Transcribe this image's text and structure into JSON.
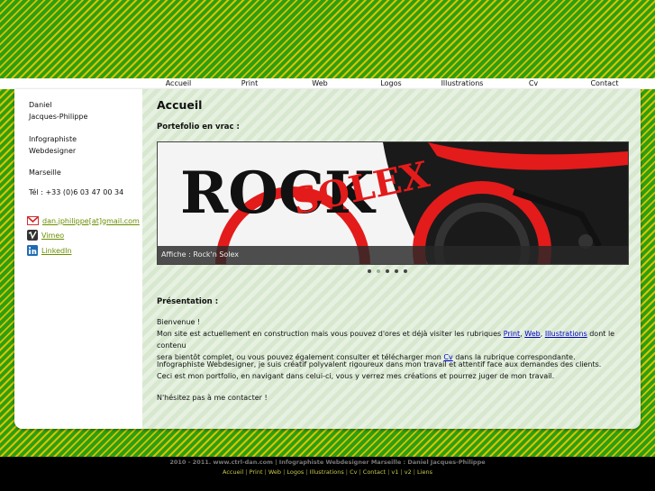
{
  "nav": {
    "items": [
      "Accueil",
      "Print",
      "Web",
      "Logos",
      "Illustrations",
      "Cv",
      "Contact"
    ]
  },
  "sidebar": {
    "name_line1": "Daniel",
    "name_line2": "Jacques-Philippe",
    "job_line1": "Infographiste",
    "job_line2": "Webdesigner",
    "city": "Marseille",
    "phone": "Tél : +33 (0)6 03 47 00 34",
    "links": [
      {
        "icon": "gmail-icon",
        "label": "dan.jphilippe[at]gmail.com"
      },
      {
        "icon": "vimeo-icon",
        "label": "Vimeo"
      },
      {
        "icon": "linkedin-icon",
        "label": "LinkedIn"
      }
    ]
  },
  "main": {
    "title": "Accueil",
    "portfolio_heading": "Portefolio en vrac :",
    "slider": {
      "caption": "Affiche : Rock'n Solex",
      "poster_text_1": "ROCK",
      "poster_text_2": "SOLEX",
      "dots_total": 5,
      "active_dot": 2
    },
    "presentation_heading": "Présentation :",
    "p1_l1": "Bienvenue !",
    "p1_l2_a": "Mon site est actuellement en construction mais vous pouvez d'ores et déjà visiter les rubriques ",
    "p1_link_print": "Print",
    "p1_sep1": ", ",
    "p1_link_web": "Web",
    "p1_sep2": ", ",
    "p1_link_illus": "Illustrations",
    "p1_l2_b": " dont le contenu",
    "p1_l3_a": "sera bientôt complet, ou vous pouvez également consulter et télécharger mon ",
    "p1_link_cv": "Cv",
    "p1_l3_b": " dans la rubrique correspondante.",
    "p2_l1": "Infographiste Webdesigner, je suis créatif polyvalent rigoureux dans mon travail et attentif face aux demandes des clients.",
    "p2_l2": "Ceci est mon portfolio, en navigant dans celui-ci, vous y verrez mes créations et pourrez juger de mon travail.",
    "p3": "N'hésitez pas à me contacter !"
  },
  "footer": {
    "line1": "2010 - 2011. www.ctrl-dan.com | Infographiste Webdesigner Marseille : Daniel Jacques-Philippe",
    "links": [
      "Accueil",
      "Print",
      "Web",
      "Logos",
      "Illustrations",
      "Cv",
      "Contact",
      "v1",
      "v2",
      "Liens"
    ],
    "separator": " | "
  },
  "colors": {
    "stripe_green": "#2e9e13",
    "stripe_yellow": "#d9c400",
    "content_stripe": "#d7e8cf",
    "sidebar_link": "#6b8e00",
    "text_link": "#0000cc"
  }
}
